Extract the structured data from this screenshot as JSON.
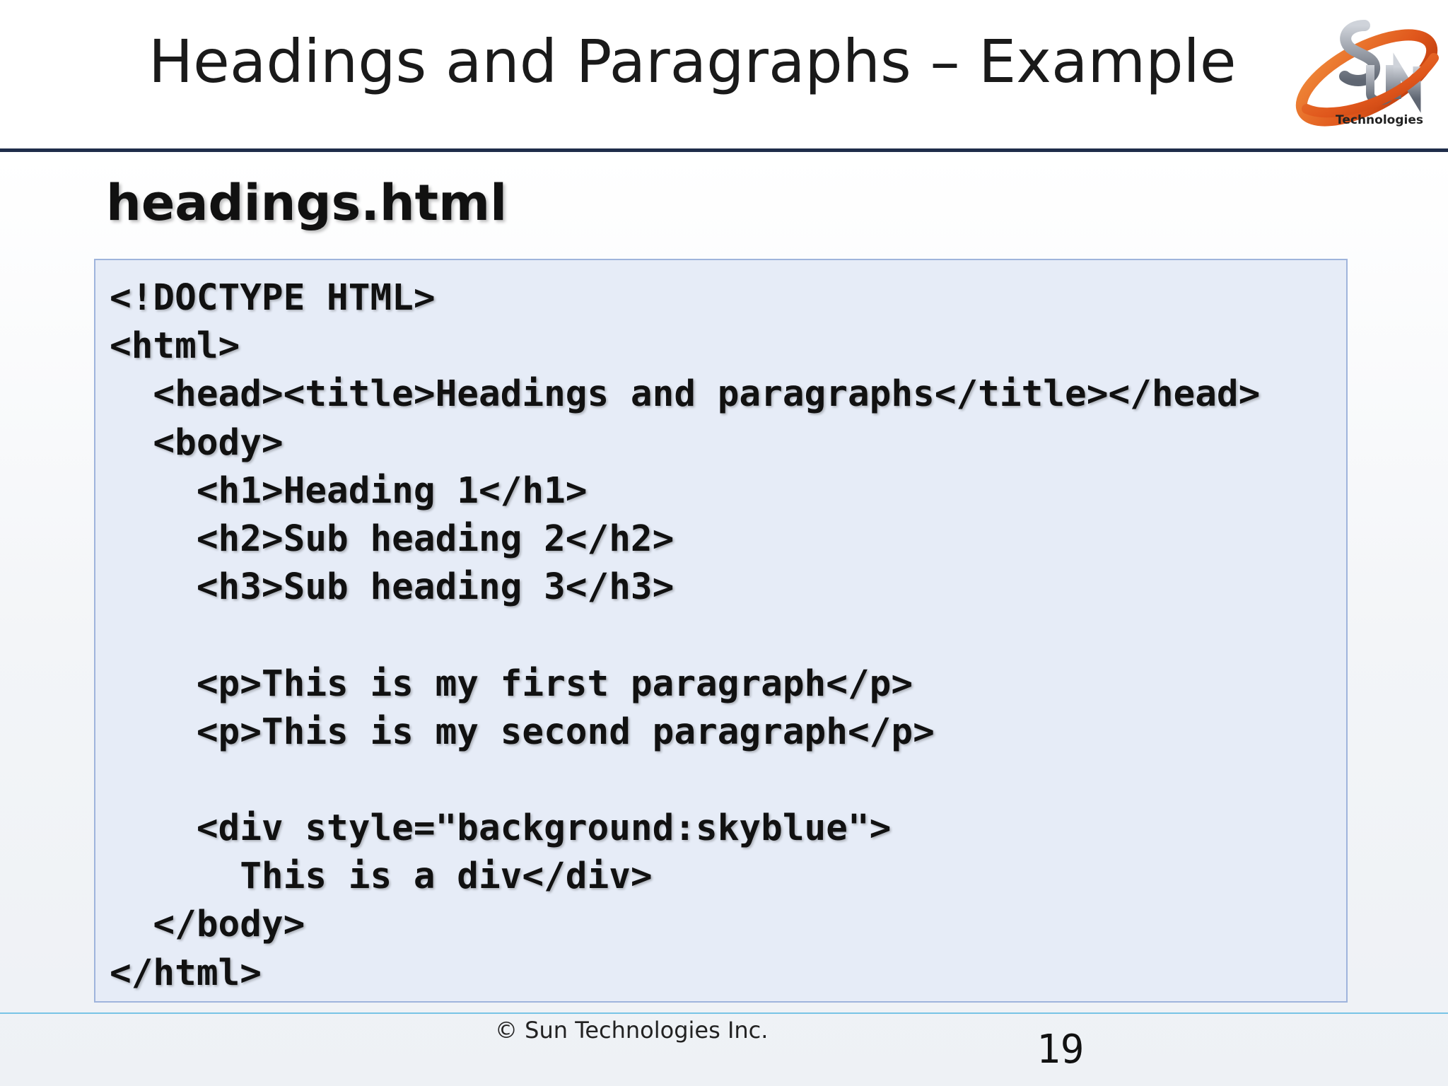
{
  "slide": {
    "title": "Headings and Paragraphs – Example",
    "logo_caption": "Technologies",
    "logo_icon": "sun-technologies-logo-icon",
    "accent_colors": {
      "header_rule": "#1f2d4a",
      "code_background": "#e6ecf7",
      "code_border": "#9fb4dc",
      "footer_rule": "#79c4e6",
      "logo_orange": "#e0571c"
    }
  },
  "file_heading": "headings.html",
  "code_lines": [
    "<!DOCTYPE HTML>",
    "<html>",
    "  <head><title>Headings and paragraphs</title></head>",
    "  <body>",
    "    <h1>Heading 1</h1>",
    "    <h2>Sub heading 2</h2>",
    "    <h3>Sub heading 3</h3>",
    "",
    "    <p>This is my first paragraph</p>",
    "    <p>This is my second paragraph</p>",
    "",
    "    <div style=\"background:skyblue\">",
    "      This is a div</div>",
    "  </body>",
    "</html>"
  ],
  "footer": {
    "copyright": "© Sun Technologies Inc.",
    "page_number": "19"
  }
}
